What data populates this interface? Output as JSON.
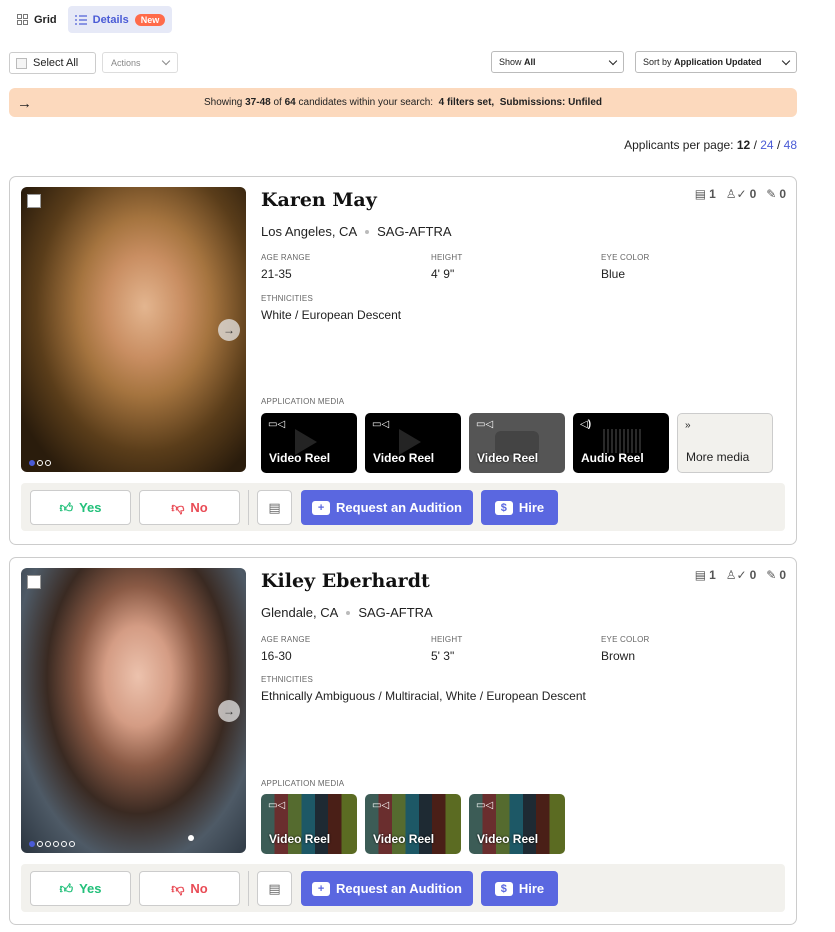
{
  "view_tabs": [
    {
      "label": "Grid",
      "icon": "grid-icon"
    },
    {
      "label": "Details",
      "icon": "list-icon",
      "badge": "New"
    }
  ],
  "toolbar": {
    "select_all_label": "Select All",
    "actions_label": "Actions",
    "show_prefix": "Show",
    "show_value": "All",
    "sort_prefix": "Sort by",
    "sort_value": "Application Updated"
  },
  "banner": {
    "prefix": "Showing",
    "range": "37-48",
    "of": "of",
    "total": "64",
    "mid": "candidates within your search:",
    "filters": "4 filters set,",
    "submissions": "Submissions: Unfiled"
  },
  "per_page": {
    "label": "Applicants per page:",
    "current": "12",
    "sep": "/",
    "opt2": "24",
    "opt3": "48"
  },
  "attr_labels": {
    "age": "AGE RANGE",
    "height": "HEIGHT",
    "eye": "EYE COLOR",
    "eth": "ETHNICITIES",
    "media": "APPLICATION MEDIA"
  },
  "action_labels": {
    "yes": "Yes",
    "no": "No",
    "audition": "Request an Audition",
    "hire": "Hire",
    "more_media": "More media"
  },
  "candidates": [
    {
      "name": "Karen May",
      "location": "Los Angeles, CA",
      "union": "SAG-AFTRA",
      "stats": {
        "resumes": "1",
        "reviews": "0",
        "notes": "0"
      },
      "age_range": "21-35",
      "height": "4' 9\"",
      "eye_color": "Blue",
      "ethnicities": "White / European Descent",
      "media": [
        "Video Reel",
        "Video Reel",
        "Video Reel",
        "Audio Reel"
      ]
    },
    {
      "name": "Kiley Eberhardt",
      "location": "Glendale, CA",
      "union": "SAG-AFTRA",
      "stats": {
        "resumes": "1",
        "reviews": "0",
        "notes": "0"
      },
      "age_range": "16-30",
      "height": "5' 3\"",
      "eye_color": "Brown",
      "ethnicities": "Ethnically Ambiguous / Multiracial, White / European Descent",
      "media": [
        "Video Reel",
        "Video Reel",
        "Video Reel"
      ]
    }
  ],
  "colors": {
    "accent": "#5a67e0",
    "banner": "#fcd9bd",
    "yes": "#22c07a",
    "no": "#e94b55"
  }
}
